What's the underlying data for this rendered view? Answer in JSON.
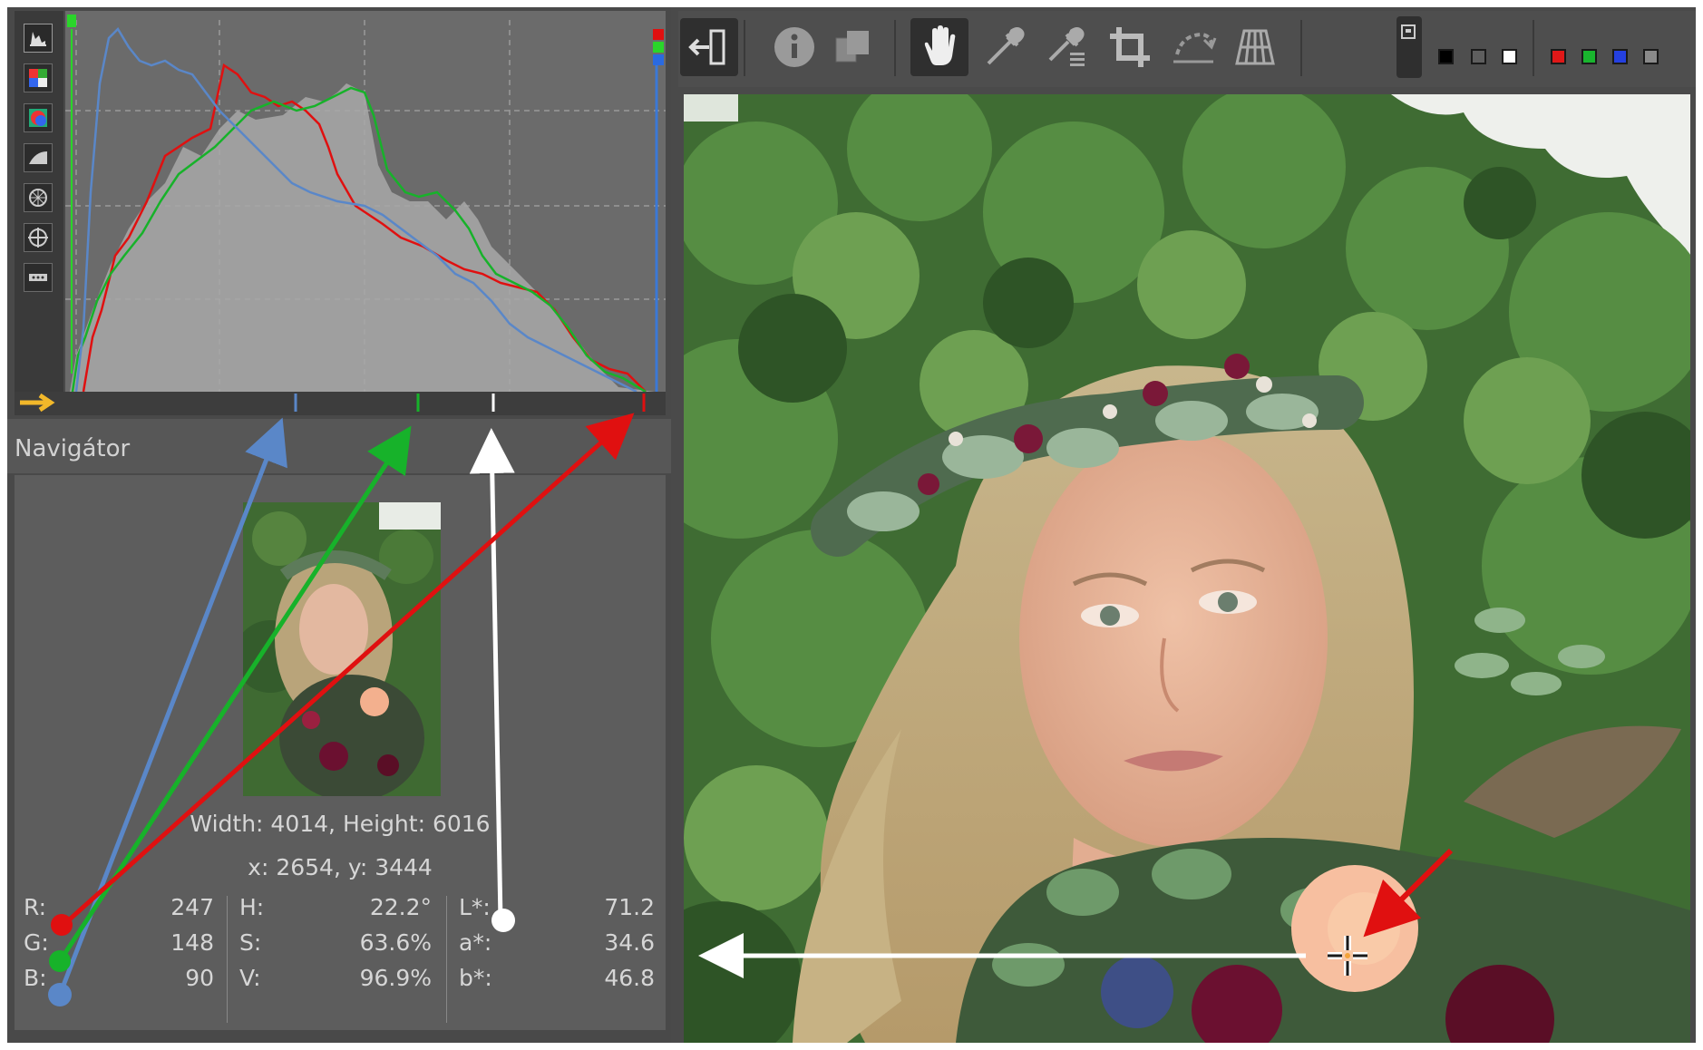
{
  "navigator": {
    "title": "Navigátor",
    "dimensions": "Width: 4014, Height: 6016",
    "coords": "x: 2654, y: 3444"
  },
  "readout": {
    "rgb": [
      {
        "label": "R:",
        "value": "247"
      },
      {
        "label": "G:",
        "value": "148"
      },
      {
        "label": "B:",
        "value": "90"
      }
    ],
    "hsv": [
      {
        "label": "H:",
        "value": "22.2°"
      },
      {
        "label": "S:",
        "value": "63.6%"
      },
      {
        "label": "V:",
        "value": "96.9%"
      }
    ],
    "lab": [
      {
        "label": "L*:",
        "value": "71.2"
      },
      {
        "label": "a*:",
        "value": "34.6"
      },
      {
        "label": "b*:",
        "value": "46.8"
      }
    ]
  },
  "colors": {
    "red": "#e01010",
    "green": "#17b22a",
    "blue": "#5a87c8",
    "white": "#ffffff",
    "yellow": "#f2b82a",
    "panel": "#5d5d5d"
  },
  "icons": {
    "histogram_toolbar": [
      "histogram-icon",
      "rgb-channels-icon",
      "color-wheel-icon",
      "raw-histogram-icon",
      "chroma-icon",
      "crosshair-icon",
      "more-icon"
    ],
    "main_toolbar": [
      "collapse-panel-icon",
      "info-icon",
      "before-after-icon",
      "hand-pan-icon",
      "color-picker-icon",
      "white-balance-picker-icon",
      "crop-icon",
      "straighten-icon",
      "perspective-icon"
    ]
  }
}
